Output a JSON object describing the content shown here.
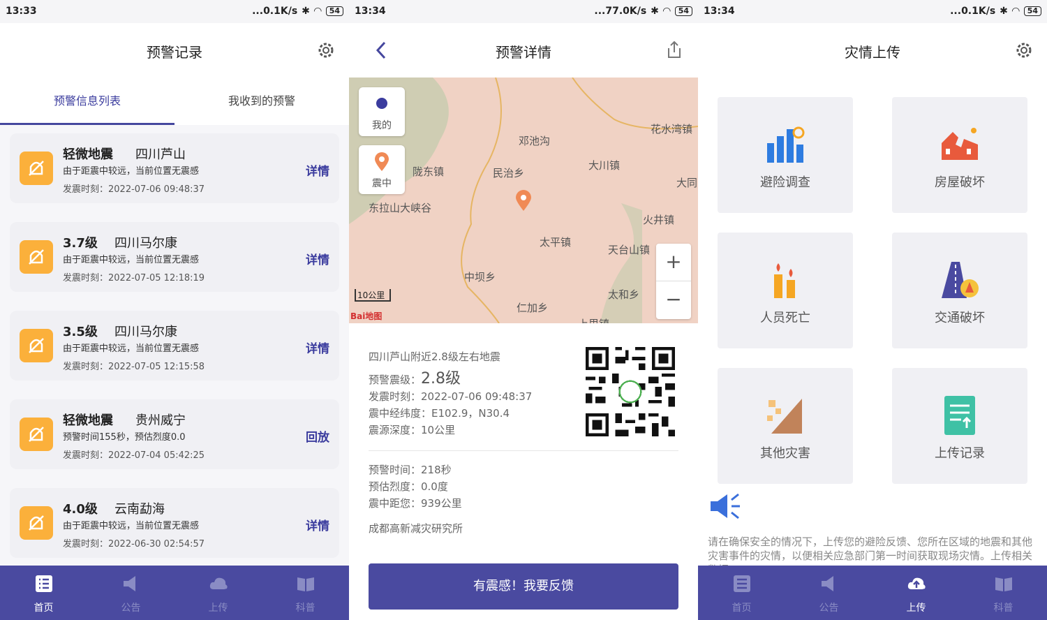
{
  "screen1": {
    "status": {
      "time": "13:33",
      "net": "...0.1K/s",
      "battery": "54"
    },
    "title": "预警记录",
    "tabs": [
      "预警信息列表",
      "我收到的预警"
    ],
    "cards": [
      {
        "mag": "轻微地震",
        "place": "四川芦山",
        "desc": "由于距震中较远，当前位置无震感",
        "ts": "发震时刻：2022-07-06 09:48:37",
        "action": "详情"
      },
      {
        "mag": "3.7级",
        "place": "四川马尔康",
        "desc": "由于距震中较远，当前位置无震感",
        "ts": "发震时刻：2022-07-05 12:18:19",
        "action": "详情"
      },
      {
        "mag": "3.5级",
        "place": "四川马尔康",
        "desc": "由于距震中较远，当前位置无震感",
        "ts": "发震时刻：2022-07-05 12:15:58",
        "action": "详情"
      },
      {
        "mag": "轻微地震",
        "place": "贵州威宁",
        "desc": "预警时间155秒，预估烈度0.0",
        "ts": "发震时刻：2022-07-04 05:42:25",
        "action": "回放"
      },
      {
        "mag": "4.0级",
        "place": "云南勐海",
        "desc": "由于距震中较远，当前位置无震感",
        "ts": "发震时刻：2022-06-30 02:54:57",
        "action": "详情"
      }
    ],
    "nav": [
      "首页",
      "公告",
      "上传",
      "科普"
    ]
  },
  "screen2": {
    "status": {
      "time": "13:34",
      "net": "...77.0K/s",
      "battery": "54"
    },
    "title": "预警详情",
    "map": {
      "mine": "我的",
      "epicenter": "震中",
      "scale": "10公里",
      "logo": "Bai地图",
      "labels": [
        "邓池沟",
        "花水湾镇",
        "陇东镇",
        "民治乡",
        "大川镇",
        "大同",
        "东拉山大峡谷",
        "火井镇",
        "太平镇",
        "天台山镇",
        "中坝乡",
        "太和乡",
        "仁加乡",
        "上里镇"
      ]
    },
    "headline": "四川芦山附近2.8级左右地震",
    "level_label": "预警震级：",
    "level_value": "2.8级",
    "time": "发震时刻：2022-07-06 09:48:37",
    "coords": "震中经纬度：E102.9，N30.4",
    "depth": "震源深度：10公里",
    "warn_time": "预警时间：218秒",
    "intensity": "预估烈度：0.0度",
    "distance": "震中距您：939公里",
    "source": "成都高新减灾研究所",
    "feedback": "有震感！我要反馈"
  },
  "screen3": {
    "status": {
      "time": "13:34",
      "net": "...0.1K/s",
      "battery": "54"
    },
    "title": "灾情上传",
    "tiles": [
      "避险调查",
      "房屋破坏",
      "人员死亡",
      "交通破坏",
      "其他灾害",
      "上传记录"
    ],
    "notice": "请在确保安全的情况下，上传您的避险反馈、您所在区域的地震和其他灾害事件的灾情，以便相关应急部门第一时间获取现场灾情。上传相关数据",
    "nav": [
      "首页",
      "公告",
      "上传",
      "科普"
    ]
  },
  "colors": {
    "primary": "#4a4aa0",
    "bell": "#fbb03b",
    "map": "#f0d2c4"
  }
}
